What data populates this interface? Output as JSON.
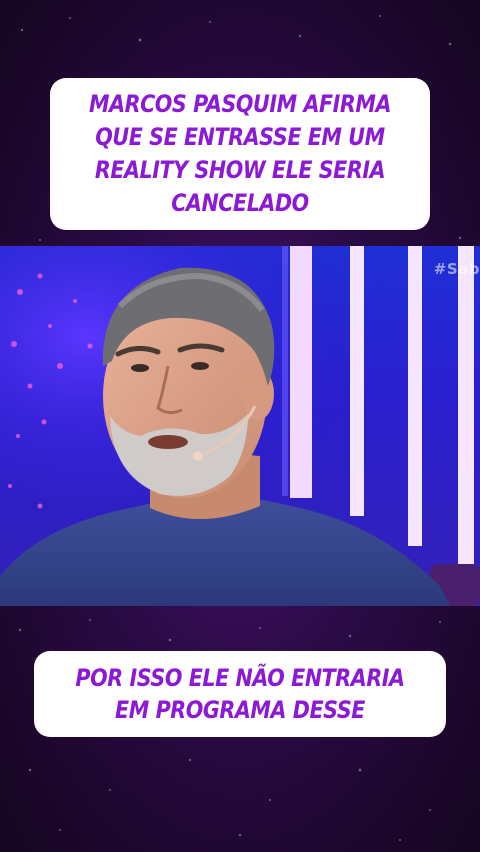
{
  "captions": {
    "top": "MARCOS PASQUIM AFIRMA QUE SE ENTRASSE EM UM REALITY SHOW ELE SERIA CANCELADO",
    "bottom": "POR ISSO ELE NÃO ENTRARIA EM PROGRAMA DESSE"
  },
  "video": {
    "watermark": "#Sab"
  },
  "colors": {
    "caption_text": "#8b19d6",
    "caption_bg": "#ffffff",
    "background": "#2a0a45",
    "studio_blue": "#2a1fcf"
  }
}
